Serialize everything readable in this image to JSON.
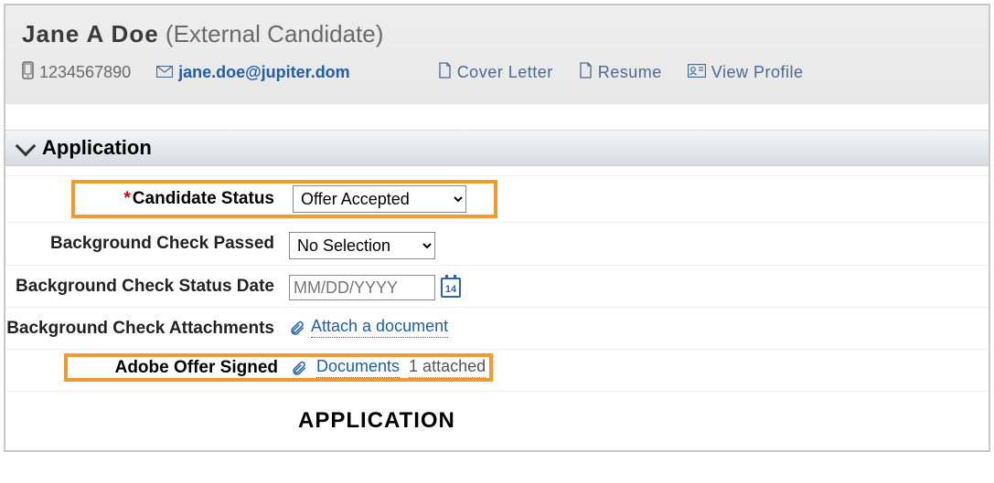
{
  "header": {
    "candidate_name": "Jane  A  Doe",
    "candidate_type": "(External Candidate)",
    "phone": "1234567890",
    "email": "jane.doe@jupiter.dom",
    "links": {
      "cover_letter": "Cover  Letter",
      "resume": "Resume",
      "view_profile": "View  Profile"
    }
  },
  "section": {
    "title": "Application"
  },
  "form": {
    "candidate_status": {
      "label": "Candidate Status",
      "value": "Offer Accepted",
      "required": true
    },
    "bg_check_passed": {
      "label": "Background Check Passed",
      "value": "No Selection"
    },
    "bg_check_date": {
      "label": "Background Check Status Date",
      "placeholder": "MM/DD/YYYY",
      "cal_day": "14"
    },
    "bg_check_attach": {
      "label": "Background Check Attachments",
      "link": "Attach a document"
    },
    "adobe_signed": {
      "label": "Adobe Offer Signed",
      "link": "Documents",
      "attached_suffix": "1 attached"
    }
  },
  "subheading": "APPLICATION"
}
